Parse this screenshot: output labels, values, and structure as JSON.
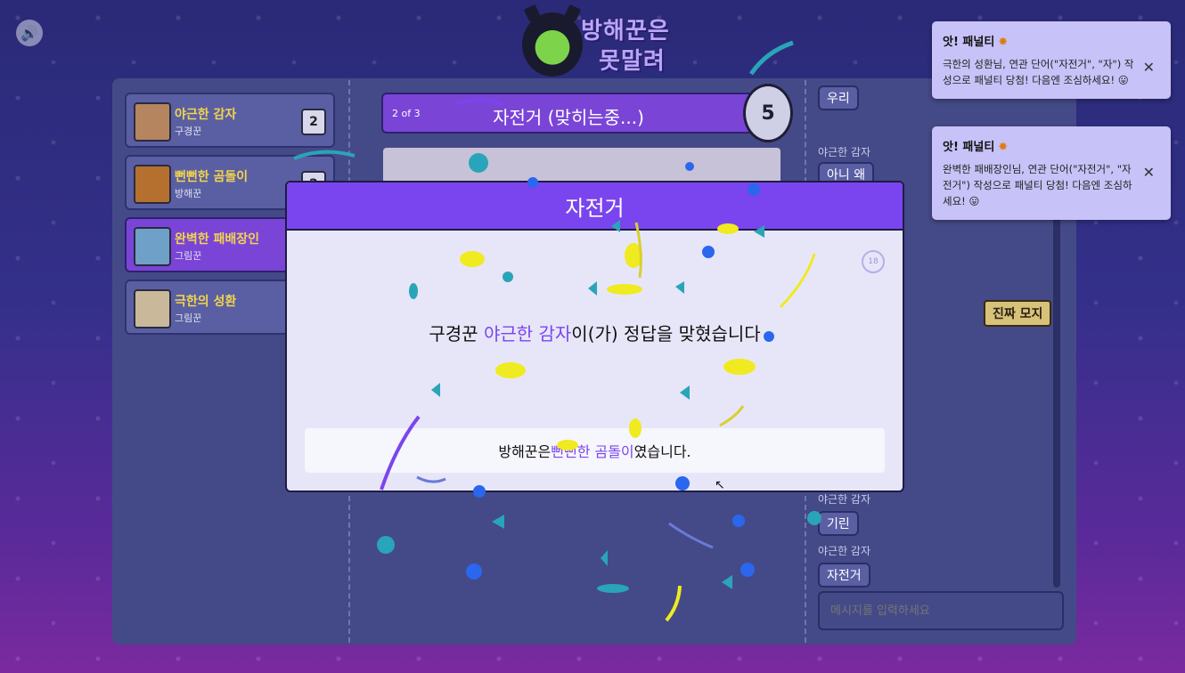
{
  "logo": {
    "line1": "방해꾼은",
    "line2": "못말려"
  },
  "players": [
    {
      "name": "야근한 감자",
      "role": "구경꾼",
      "score": "2",
      "active": false,
      "avatar_color": "#b5855f"
    },
    {
      "name": "뻔뻔한 곰돌이",
      "role": "방해꾼",
      "score": "2",
      "active": false,
      "avatar_color": "#b5702f"
    },
    {
      "name": "완벽한 패배장인",
      "role": "그림꾼",
      "score": "",
      "active": true,
      "avatar_color": "#6fa0c8"
    },
    {
      "name": "극한의 성환",
      "role": "그림꾼",
      "score": "",
      "active": false,
      "avatar_color": "#c9b89a"
    }
  ],
  "round": {
    "label": "2 of 3",
    "word": "자전거 (맞히는중...)",
    "timer": "5"
  },
  "chat": {
    "messages": [
      {
        "user": "",
        "text": "우리"
      },
      {
        "user": "야근한 감자",
        "text": "아니 왜"
      },
      {
        "user": "야근한 감자",
        "text": "기린"
      },
      {
        "user": "야근한 감자",
        "text": "자전거"
      }
    ],
    "extra_label": "야근한 감자",
    "input_placeholder": "메시지를 입력하세요",
    "emote_label": "진짜 모지"
  },
  "toasts": [
    {
      "title": "앗! 패널티",
      "icon": "explosion-icon",
      "body": "극한의 성환님, 연관 단어(\"자전거\", \"자\") 작성으로 패널티 당첨! 다음엔 조심하세요! 😛"
    },
    {
      "title": "앗! 패널티",
      "icon": "explosion-icon",
      "body": "완벽한 패배장인님, 연관 단어(\"자전거\", \"자전거\") 작성으로 패널티 당첨! 다음엔 조심하세요! 😛"
    }
  ],
  "modal": {
    "title": "자전거",
    "countdown": "18",
    "result_prefix": "구경꾼 ",
    "result_name": "야근한 감자",
    "result_suffix": "이(가) 정답을 맞혔습니다",
    "spoiler_prefix": "방해꾼은 ",
    "spoiler_name": "뻔뻔한 곰돌이",
    "spoiler_suffix": "였습니다."
  },
  "colors": {
    "accent": "#7a45ee",
    "highlight_name": "#f2d44c",
    "board": "#444a87"
  }
}
